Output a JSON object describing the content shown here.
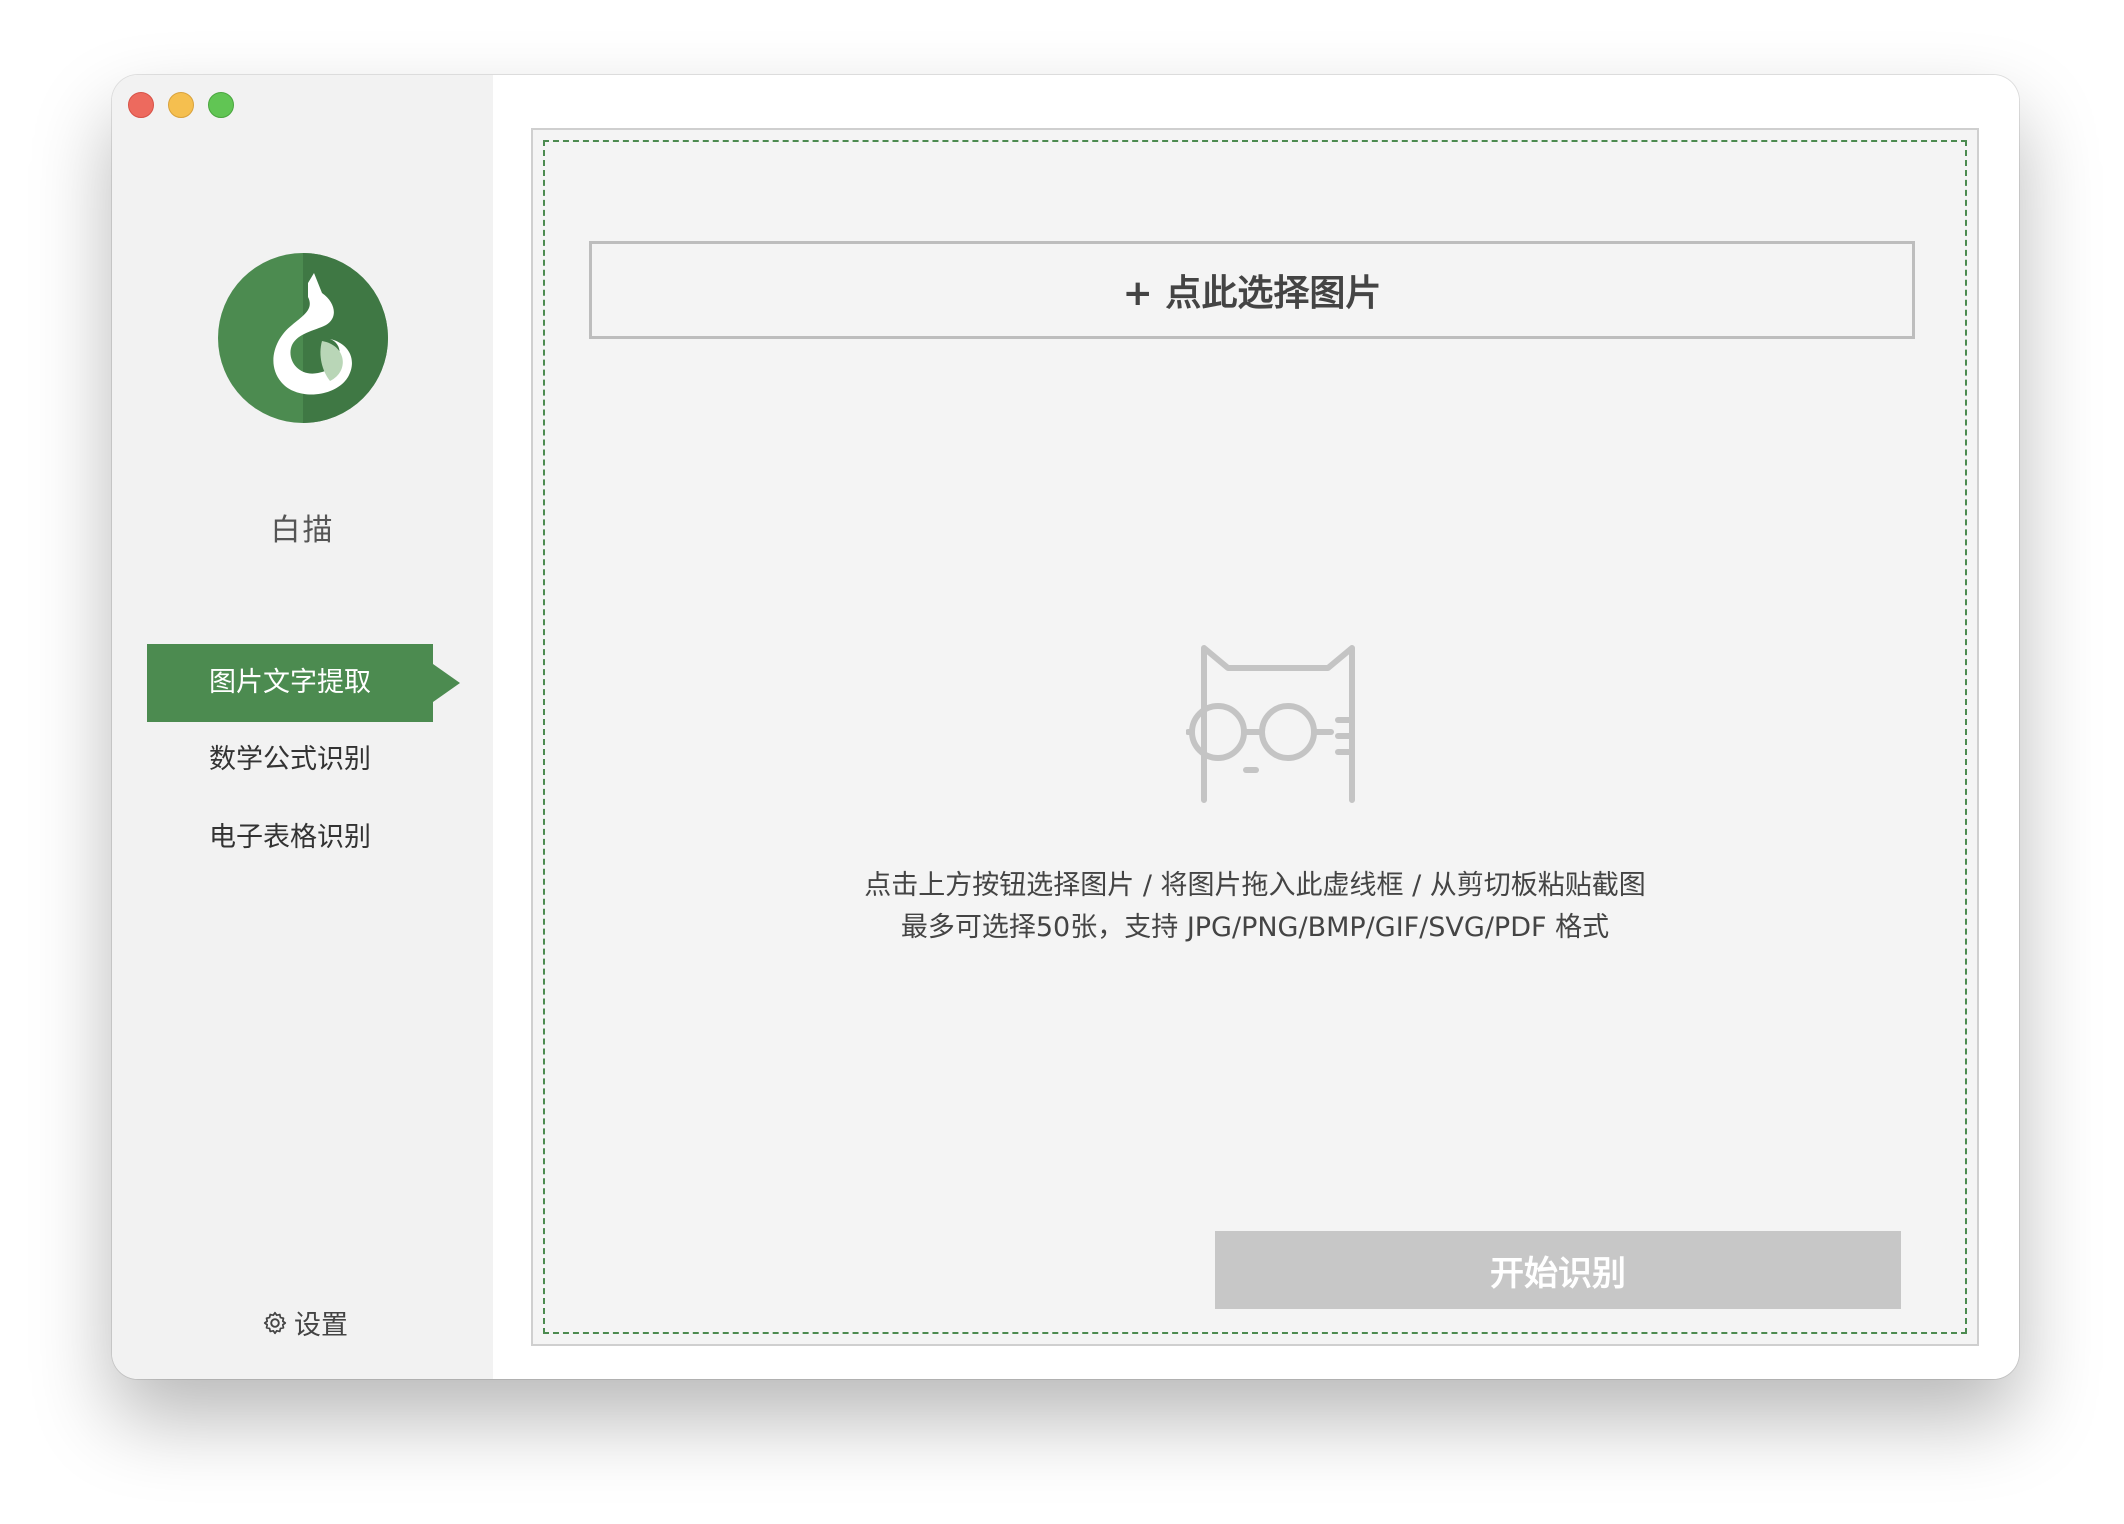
{
  "window": {
    "controls": [
      "close",
      "minimize",
      "zoom"
    ]
  },
  "sidebar": {
    "app_name": "白描",
    "items": [
      {
        "label": "图片文字提取",
        "active": true
      },
      {
        "label": "数学公式识别",
        "active": false
      },
      {
        "label": "电子表格识别",
        "active": false
      }
    ],
    "settings_label": "设置",
    "logo_icon": "white-cat-logo-icon",
    "settings_icon": "gear-icon"
  },
  "main": {
    "select_button_label": "+ 点此选择图片",
    "hint_line1": "点击上方按钮选择图片 / 将图片拖入此虚线框 / 从剪切板粘贴截图",
    "hint_line2": "最多可选择50张，支持 JPG/PNG/BMP/GIF/SVG/PDF 格式",
    "start_button_label": "开始识别",
    "illustration_icon": "cat-glasses-icon"
  },
  "colors": {
    "accent": "#4c8b50",
    "disabled_button": "#c7c7c7",
    "sidebar_bg": "#f2f2f2"
  }
}
